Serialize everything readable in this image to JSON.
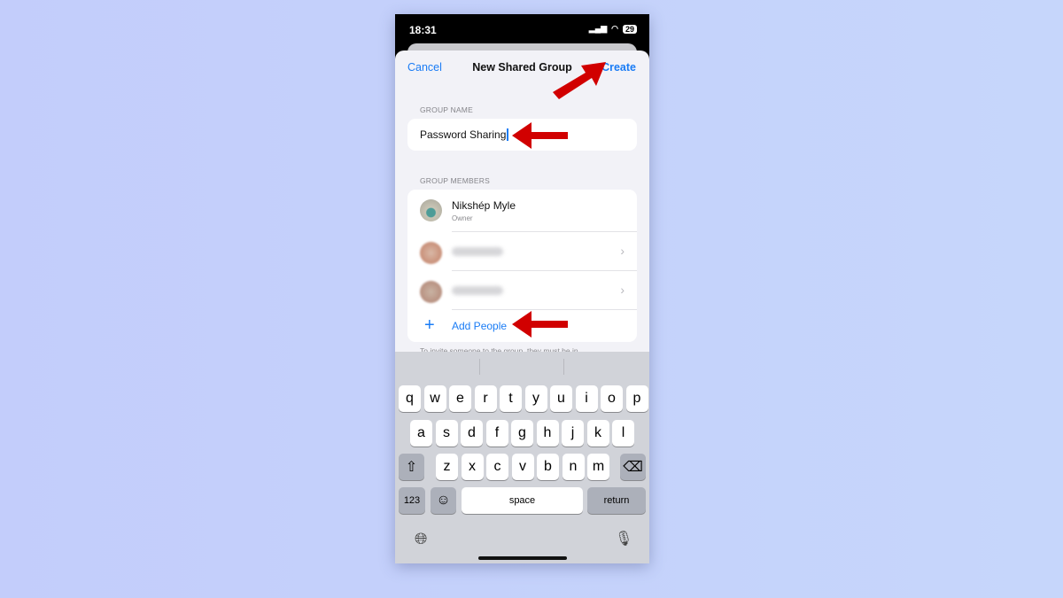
{
  "status": {
    "time": "18:31",
    "battery": "29"
  },
  "nav": {
    "cancel": "Cancel",
    "title": "New Shared Group",
    "create": "Create"
  },
  "group_name": {
    "label": "GROUP NAME",
    "value": "Password Sharing"
  },
  "members": {
    "label": "GROUP MEMBERS",
    "owner": {
      "name": "Nikshép Myle",
      "role": "Owner"
    },
    "add": "Add People"
  },
  "footer": "To invite someone to the group, they must be in",
  "keyboard": {
    "row1": [
      "q",
      "w",
      "e",
      "r",
      "t",
      "y",
      "u",
      "i",
      "o",
      "p"
    ],
    "row2": [
      "a",
      "s",
      "d",
      "f",
      "g",
      "h",
      "j",
      "k",
      "l"
    ],
    "row3": [
      "z",
      "x",
      "c",
      "v",
      "b",
      "n",
      "m"
    ],
    "numbers": "123",
    "space": "space",
    "return": "return"
  },
  "colors": {
    "accent": "#1a7cf5",
    "annotation_arrow": "#d10000"
  }
}
